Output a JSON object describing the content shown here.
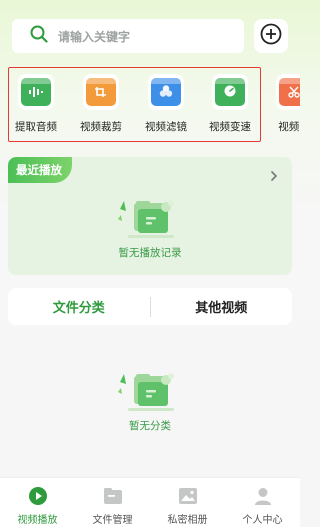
{
  "search": {
    "placeholder": "请输入关键字"
  },
  "colors": {
    "accent": "#2e9b3d",
    "highlight_frame": "#e53935"
  },
  "tools": [
    {
      "label": "提取音频",
      "icon": "audio-wave-icon",
      "color": "#3fb15a"
    },
    {
      "label": "视频裁剪",
      "icon": "crop-icon",
      "color": "#f39a3a"
    },
    {
      "label": "视频滤镜",
      "icon": "filter-icon",
      "color": "#3e8fe8"
    },
    {
      "label": "视频变速",
      "icon": "speed-icon",
      "color": "#3fb15a"
    },
    {
      "label": "视频剪",
      "icon": "cut-icon",
      "color": "#f0704a"
    }
  ],
  "recent": {
    "title": "最近播放",
    "empty_text": "暂无播放记录"
  },
  "file_tabs": {
    "category": "文件分类",
    "other": "其他视频"
  },
  "category": {
    "empty_text": "暂无分类"
  },
  "nav": [
    {
      "label": "视频播放",
      "icon": "play-icon",
      "active": true
    },
    {
      "label": "文件管理",
      "icon": "folder-icon",
      "active": false
    },
    {
      "label": "私密相册",
      "icon": "image-icon",
      "active": false
    },
    {
      "label": "个人中心",
      "icon": "person-icon",
      "active": false
    }
  ]
}
